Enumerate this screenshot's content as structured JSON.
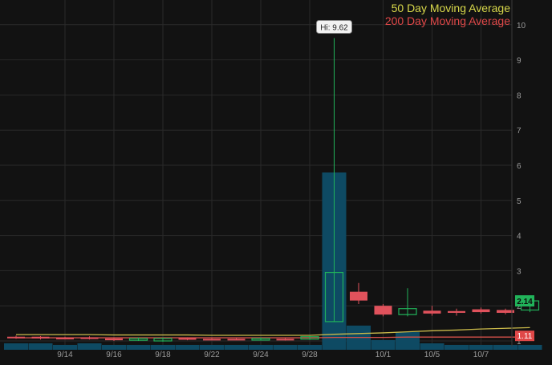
{
  "chart_data": {
    "type": "candlestick",
    "title": "",
    "xlabel": "",
    "ylabel": "",
    "ylim": [
      0.9,
      10.3
    ],
    "grid": true,
    "legend": {
      "placement": "top-right",
      "entries": [
        {
          "label": "50 Day Moving Average",
          "color": "#d8d84a"
        },
        {
          "label": "200 Day Moving Average",
          "color": "#e04848"
        }
      ]
    },
    "y_ticks": [
      "1",
      "2",
      "3",
      "4",
      "5",
      "6",
      "7",
      "8",
      "9",
      "10"
    ],
    "x_tick_labels": [
      {
        "index": 2,
        "label": "9/14"
      },
      {
        "index": 4,
        "label": "9/16"
      },
      {
        "index": 6,
        "label": "9/18"
      },
      {
        "index": 8,
        "label": "9/22"
      },
      {
        "index": 10,
        "label": "9/24"
      },
      {
        "index": 12,
        "label": "9/28"
      },
      {
        "index": 15,
        "label": "10/1"
      },
      {
        "index": 17,
        "label": "10/5"
      },
      {
        "index": 19,
        "label": "10/7"
      }
    ],
    "candles": [
      {
        "open": 1.12,
        "close": 1.1,
        "high": 1.15,
        "low": 1.06
      },
      {
        "open": 1.12,
        "close": 1.07,
        "high": 1.14,
        "low": 1.04
      },
      {
        "open": 1.09,
        "close": 1.08,
        "high": 1.12,
        "low": 1.05
      },
      {
        "open": 1.1,
        "close": 1.07,
        "high": 1.13,
        "low": 1.04
      },
      {
        "open": 1.07,
        "close": 1.02,
        "high": 1.1,
        "low": 1.0
      },
      {
        "open": 1.02,
        "close": 1.07,
        "high": 1.1,
        "low": 1.0
      },
      {
        "open": 1.0,
        "close": 1.07,
        "high": 1.1,
        "low": 0.98
      },
      {
        "open": 1.08,
        "close": 1.04,
        "high": 1.1,
        "low": 1.02
      },
      {
        "open": 1.06,
        "close": 1.04,
        "high": 1.08,
        "low": 1.02
      },
      {
        "open": 1.06,
        "close": 1.04,
        "high": 1.08,
        "low": 1.03
      },
      {
        "open": 1.03,
        "close": 1.07,
        "high": 1.1,
        "low": 1.01
      },
      {
        "open": 1.06,
        "close": 1.03,
        "high": 1.08,
        "low": 1.01
      },
      {
        "open": 1.05,
        "close": 1.12,
        "high": 1.14,
        "low": 1.03
      },
      {
        "open": 1.55,
        "close": 2.95,
        "high": 9.62,
        "low": 1.55
      },
      {
        "open": 2.4,
        "close": 2.15,
        "high": 2.65,
        "low": 2.05
      },
      {
        "open": 2.0,
        "close": 1.75,
        "high": 2.05,
        "low": 1.7
      },
      {
        "open": 1.75,
        "close": 1.92,
        "high": 2.5,
        "low": 1.7
      },
      {
        "open": 1.86,
        "close": 1.78,
        "high": 2.0,
        "low": 1.72
      },
      {
        "open": 1.85,
        "close": 1.8,
        "high": 1.92,
        "low": 1.72
      },
      {
        "open": 1.9,
        "close": 1.82,
        "high": 1.95,
        "low": 1.78
      },
      {
        "open": 1.88,
        "close": 1.8,
        "high": 1.92,
        "low": 1.76
      },
      {
        "open": 1.88,
        "close": 2.14,
        "high": 2.22,
        "low": 1.82
      }
    ],
    "volume": [
      0.4,
      0.4,
      0.3,
      0.4,
      0.3,
      0.3,
      0.3,
      0.3,
      0.3,
      0.3,
      0.3,
      0.3,
      0.3,
      11.0,
      1.5,
      0.6,
      1.1,
      0.4,
      0.3,
      0.3,
      0.3,
      0.3
    ],
    "ma50": [
      1.18,
      1.18,
      1.18,
      1.18,
      1.17,
      1.17,
      1.17,
      1.17,
      1.16,
      1.16,
      1.16,
      1.16,
      1.16,
      1.19,
      1.21,
      1.23,
      1.26,
      1.29,
      1.31,
      1.34,
      1.36,
      1.38
    ],
    "ma200": [
      1.09,
      1.09,
      1.09,
      1.09,
      1.09,
      1.09,
      1.09,
      1.09,
      1.09,
      1.09,
      1.09,
      1.09,
      1.09,
      1.1,
      1.1,
      1.1,
      1.11,
      1.11,
      1.11,
      1.11,
      1.11,
      1.11
    ],
    "high_annotation": {
      "text": "Hi: 9.62",
      "index": 13,
      "value": 9.62
    },
    "last_price": {
      "text": "2.14",
      "value": 2.14
    },
    "ma_value_label": {
      "text": "1.11",
      "value": 1.11
    },
    "colors": {
      "background": "#121212",
      "up": "#21b35a",
      "down": "#e0525c",
      "volume": "#0e4a63",
      "grid": "#2a2a2a",
      "axis_text": "#9a9a9a",
      "ma50": "#c9b94a",
      "ma200": "#d2504a",
      "last_price_bg": "#21b35a",
      "ma_label_bg": "#e04848"
    }
  }
}
